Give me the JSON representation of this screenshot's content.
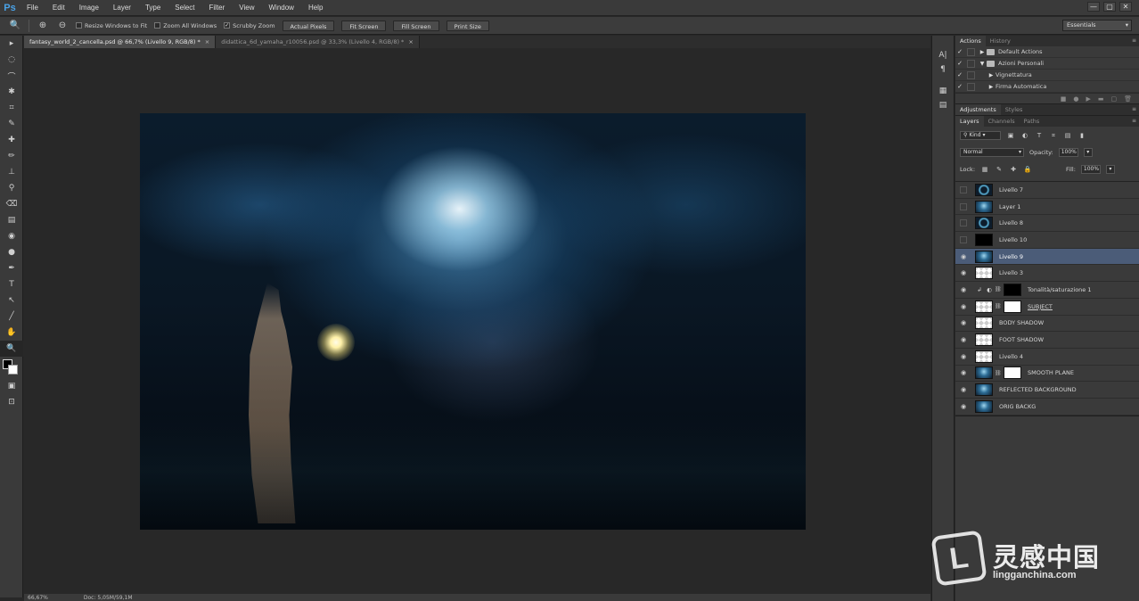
{
  "app": {
    "logo": "Ps",
    "menu": [
      "File",
      "Edit",
      "Image",
      "Layer",
      "Type",
      "Select",
      "Filter",
      "View",
      "Window",
      "Help"
    ],
    "window_controls": [
      "—",
      "▢",
      "✕"
    ]
  },
  "options": {
    "zoom_icon": "🔍",
    "resize_windows": "Resize Windows to Fit",
    "zoom_all": "Zoom All Windows",
    "scrubby_zoom": "Scrubby Zoom",
    "buttons": [
      "Actual Pixels",
      "Fit Screen",
      "Fill Screen",
      "Print Size"
    ],
    "workspace": "Essentials"
  },
  "tools": [
    "▸",
    "◌",
    "⌒",
    "✱",
    "⌗",
    "✎",
    "✚",
    "✏",
    "⊥",
    "⚲",
    "⌫",
    "▤",
    "◉",
    "●",
    "✒",
    "T",
    "↖",
    "╱",
    "✋",
    "🔍"
  ],
  "tools_bottom": [
    "▣",
    "⊡"
  ],
  "doc_tabs": [
    {
      "label": "fantasy_world_2_cancella.psd @ 66,7% (Livello 9, RGB/8) *",
      "close": "×"
    },
    {
      "label": "didattica_6d_yamaha_r10056.psd @ 33,3% (Livello 4, RGB/8) *",
      "close": "×"
    }
  ],
  "status": {
    "zoom": "66,67%",
    "doc": "Doc: 5,05M/59,1M"
  },
  "strip_icons": [
    "A|",
    "¶",
    "▦",
    "▤"
  ],
  "actions_panel": {
    "tabs": [
      "Actions",
      "History"
    ],
    "rows": [
      {
        "check": "✓",
        "tri": "▶",
        "folder": true,
        "label": "Default Actions",
        "indent": 0
      },
      {
        "check": "✓",
        "tri": "▼",
        "folder": true,
        "label": "Azioni Personali",
        "indent": 0
      },
      {
        "check": "✓",
        "tri": "▶",
        "folder": false,
        "label": "Vignettatura",
        "indent": 1
      },
      {
        "check": "✓",
        "tri": "▶",
        "folder": false,
        "label": "Firma Automatica",
        "indent": 1
      }
    ],
    "footer_icons": [
      "■",
      "●",
      "▶",
      "▬",
      "▢",
      "🗑"
    ]
  },
  "adjustments_panel": {
    "tabs": [
      "Adjustments",
      "Styles"
    ]
  },
  "layers_panel": {
    "tabs": [
      "Layers",
      "Channels",
      "Paths"
    ],
    "kind": "Kind",
    "blend_mode": "Normal",
    "opacity_label": "Opacity:",
    "opacity": "100%",
    "lock_label": "Lock:",
    "fill_label": "Fill:",
    "fill": "100%",
    "layers": [
      {
        "name": "Livello 7",
        "visible": false,
        "thumb": "ring",
        "mask": null,
        "selected": false,
        "underline": false
      },
      {
        "name": "Layer 1",
        "visible": false,
        "thumb": "dark",
        "mask": null,
        "selected": false,
        "underline": false
      },
      {
        "name": "Livello 8",
        "visible": false,
        "thumb": "ring",
        "mask": null,
        "selected": false,
        "underline": false
      },
      {
        "name": "Livello 10",
        "visible": false,
        "thumb": "black",
        "mask": null,
        "selected": false,
        "underline": false
      },
      {
        "name": "Livello 9",
        "visible": true,
        "thumb": "dark",
        "mask": null,
        "selected": true,
        "underline": false
      },
      {
        "name": "Livello 3",
        "visible": true,
        "thumb": "trans",
        "mask": null,
        "selected": false,
        "underline": false
      },
      {
        "name": "Tonalità/saturazione 1",
        "visible": true,
        "thumb": "adj",
        "mask": "black",
        "selected": false,
        "underline": false
      },
      {
        "name": "SUBJECT",
        "visible": true,
        "thumb": "trans",
        "mask": "white",
        "selected": false,
        "underline": true
      },
      {
        "name": "BODY SHADOW",
        "visible": true,
        "thumb": "trans",
        "mask": null,
        "selected": false,
        "underline": false
      },
      {
        "name": "FOOT SHADOW",
        "visible": true,
        "thumb": "trans",
        "mask": null,
        "selected": false,
        "underline": false
      },
      {
        "name": "Livello 4",
        "visible": true,
        "thumb": "trans",
        "mask": null,
        "selected": false,
        "underline": false
      },
      {
        "name": "SMOOTH PLANE",
        "visible": true,
        "thumb": "dark",
        "mask": "white",
        "selected": false,
        "underline": false
      },
      {
        "name": "REFLECTED BACKGROUND",
        "visible": true,
        "thumb": "dark",
        "mask": null,
        "selected": false,
        "underline": false
      },
      {
        "name": "ORIG BACKG",
        "visible": true,
        "thumb": "dark",
        "mask": null,
        "selected": false,
        "underline": false
      }
    ]
  },
  "watermark": {
    "badge": "L",
    "cn": "灵感中国",
    "url": "lingganchina.com"
  }
}
